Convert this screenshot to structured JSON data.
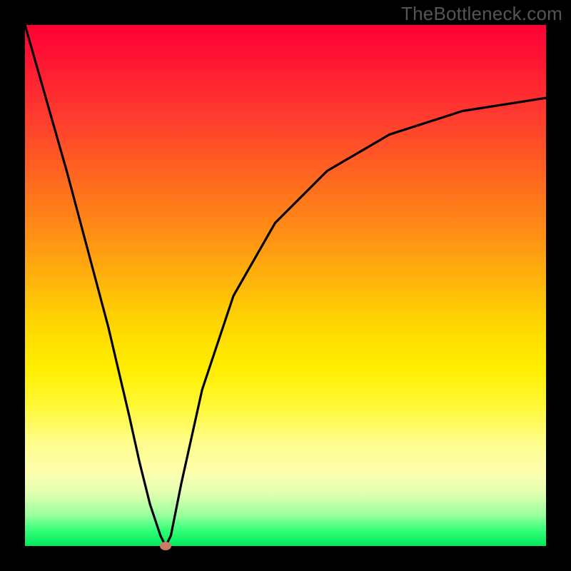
{
  "watermark": "TheBottleneck.com",
  "colors": {
    "frame": "#000000",
    "marker": "#cc7a66",
    "curve": "#000000"
  },
  "chart_data": {
    "type": "line",
    "title": "",
    "xlabel": "",
    "ylabel": "",
    "xlim": [
      0,
      100
    ],
    "ylim": [
      0,
      100
    ],
    "grid": false,
    "series": [
      {
        "name": "bottleneck-curve",
        "x": [
          0,
          4,
          8,
          12,
          16,
          20,
          22,
          24,
          26,
          27,
          28,
          30,
          34,
          40,
          48,
          58,
          70,
          84,
          100
        ],
        "y": [
          100,
          86,
          72,
          57,
          42,
          25,
          16,
          8,
          2,
          0,
          2,
          12,
          30,
          48,
          62,
          72,
          79,
          83.5,
          86
        ]
      }
    ],
    "markers": [
      {
        "name": "optimal-point",
        "x": 27,
        "y": 0
      }
    ],
    "gradient_bands": [
      {
        "y": 100,
        "color": "#ff0033"
      },
      {
        "y": 50,
        "color": "#ffd900"
      },
      {
        "y": 15,
        "color": "#fdffb0"
      },
      {
        "y": 0,
        "color": "#00e85c"
      }
    ]
  }
}
